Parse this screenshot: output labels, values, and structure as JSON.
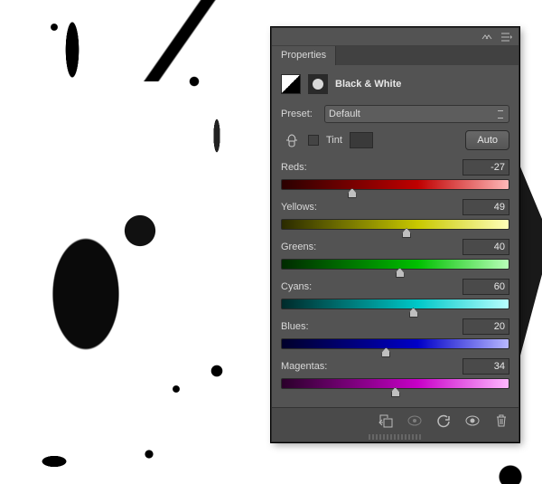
{
  "panel": {
    "title_tab": "Properties",
    "adjustment_name": "Black & White",
    "preset_label": "Preset:",
    "preset_value": "Default",
    "tint_label": "Tint",
    "auto_label": "Auto"
  },
  "sliders": [
    {
      "id": "reds",
      "label": "Reds:",
      "value": -27,
      "pos": 31,
      "grad": "grad-red"
    },
    {
      "id": "yellows",
      "label": "Yellows:",
      "value": 49,
      "pos": 55,
      "grad": "grad-yellow"
    },
    {
      "id": "greens",
      "label": "Greens:",
      "value": 40,
      "pos": 52,
      "grad": "grad-green"
    },
    {
      "id": "cyans",
      "label": "Cyans:",
      "value": 60,
      "pos": 58,
      "grad": "grad-cyan"
    },
    {
      "id": "blues",
      "label": "Blues:",
      "value": 20,
      "pos": 46,
      "grad": "grad-blue"
    },
    {
      "id": "magentas",
      "label": "Magentas:",
      "value": 34,
      "pos": 50,
      "grad": "grad-magenta"
    }
  ]
}
